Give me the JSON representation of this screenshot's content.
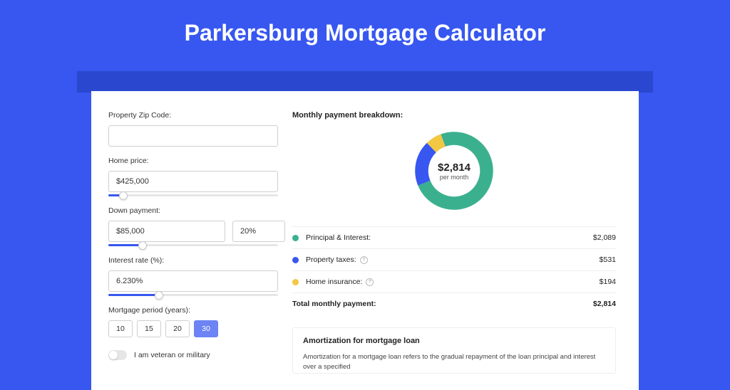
{
  "title": "Parkersburg Mortgage Calculator",
  "left": {
    "zip_label": "Property Zip Code:",
    "zip_value": "",
    "price_label": "Home price:",
    "price_value": "$425,000",
    "price_slider_pct": 9,
    "dp_label": "Down payment:",
    "dp_amount": "$85,000",
    "dp_pct": "20%",
    "dp_slider_pct": 20,
    "rate_label": "Interest rate (%):",
    "rate_value": "6.230%",
    "rate_slider_pct": 30,
    "period_label": "Mortgage period (years):",
    "periods": [
      "10",
      "15",
      "20",
      "30"
    ],
    "period_active": "30",
    "veteran_label": "I am veteran or military"
  },
  "right": {
    "breakdown_title": "Monthly payment breakdown:",
    "donut_value": "$2,814",
    "donut_sub": "per month",
    "items": [
      {
        "color": "#3bb08f",
        "label": "Principal & Interest:",
        "value": "$2,089",
        "help": false
      },
      {
        "color": "#3757f0",
        "label": "Property taxes:",
        "value": "$531",
        "help": true
      },
      {
        "color": "#f2c744",
        "label": "Home insurance:",
        "value": "$194",
        "help": true
      }
    ],
    "total_label": "Total monthly payment:",
    "total_value": "$2,814",
    "amort_title": "Amortization for mortgage loan",
    "amort_text": "Amortization for a mortgage loan refers to the gradual repayment of the loan principal and interest over a specified"
  },
  "chart_data": {
    "type": "pie",
    "title": "Monthly payment breakdown",
    "series": [
      {
        "name": "Principal & Interest",
        "value": 2089,
        "color": "#3bb08f"
      },
      {
        "name": "Property taxes",
        "value": 531,
        "color": "#3757f0"
      },
      {
        "name": "Home insurance",
        "value": 194,
        "color": "#f2c744"
      }
    ],
    "total": 2814,
    "center_label": "$2,814 per month"
  }
}
